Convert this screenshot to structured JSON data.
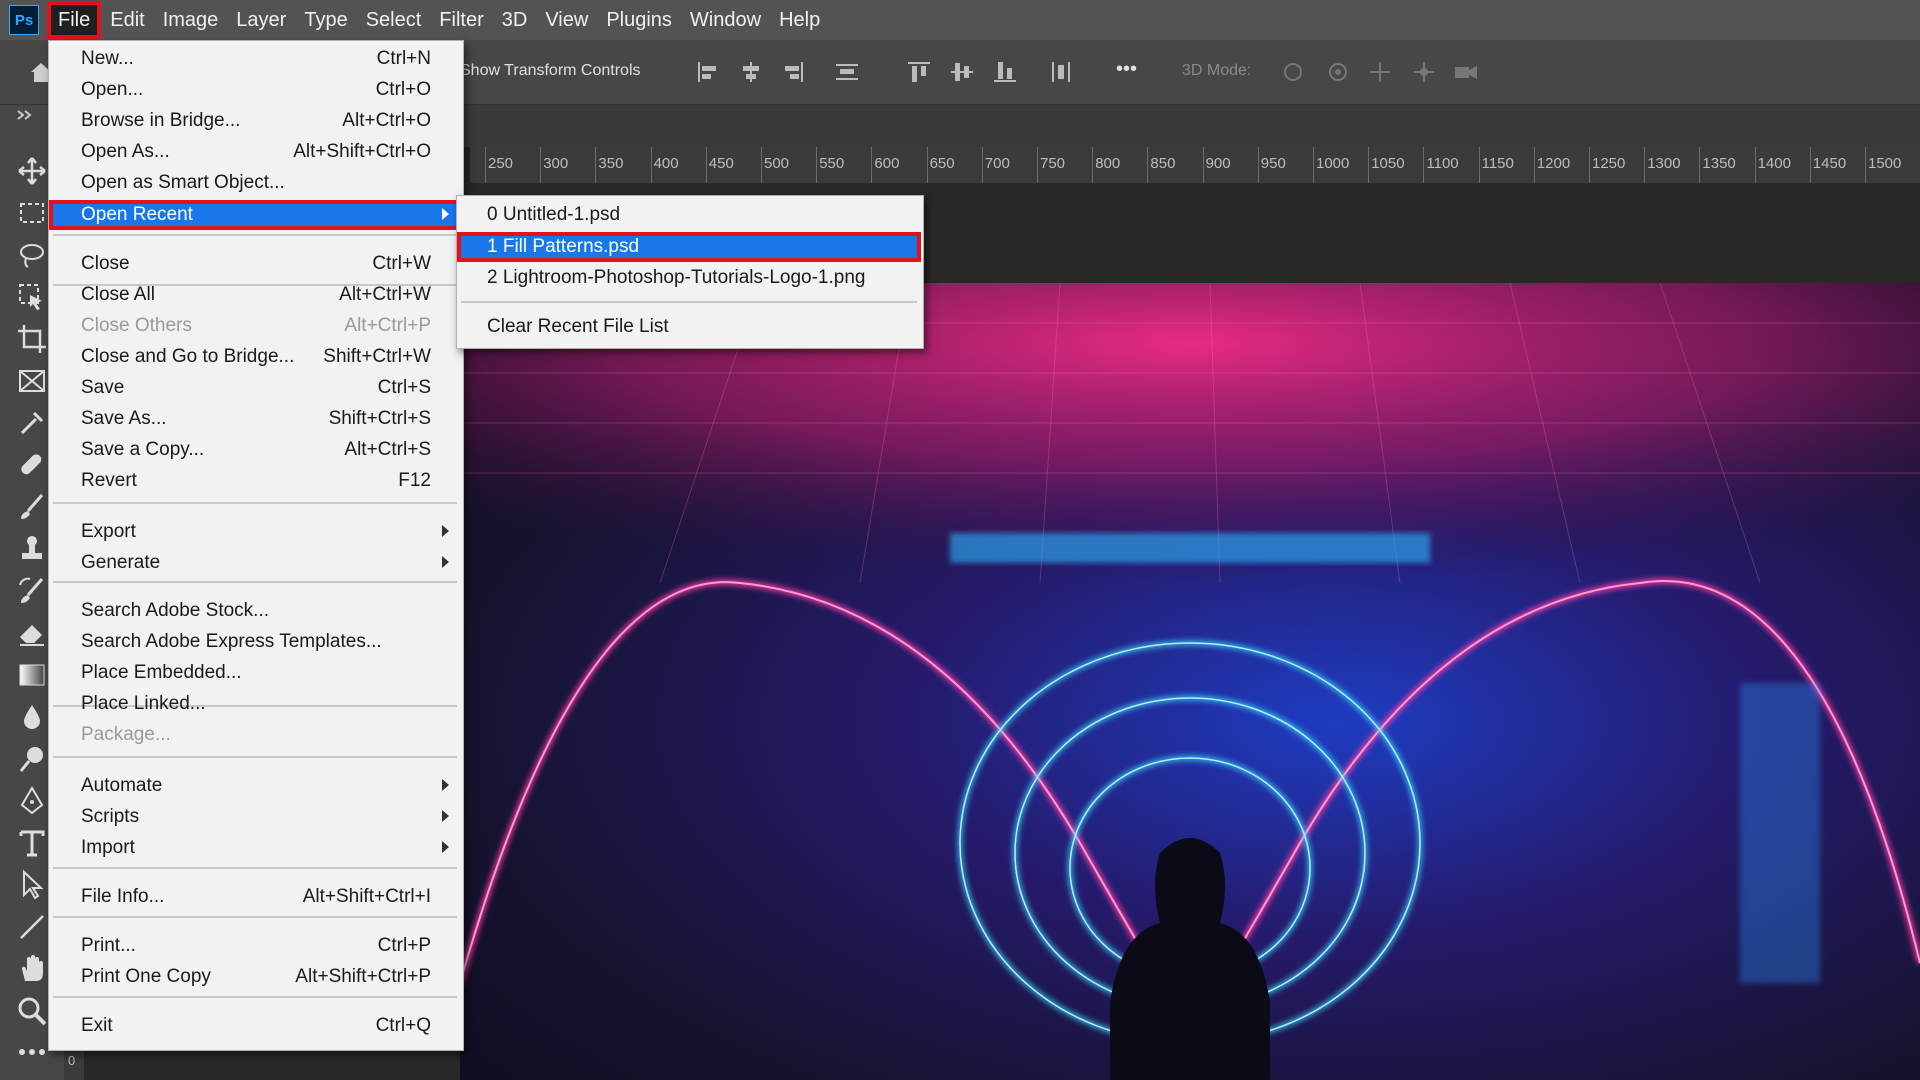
{
  "app": {
    "logo_text": "Ps",
    "accent": "#31a8ff"
  },
  "menubar": {
    "items": [
      "File",
      "Edit",
      "Image",
      "Layer",
      "Type",
      "Select",
      "Filter",
      "3D",
      "View",
      "Plugins",
      "Window",
      "Help"
    ],
    "active": "File"
  },
  "options_bar": {
    "transform_label": "Show Transform Controls",
    "mode_label": "3D Mode:",
    "more_label": "•••"
  },
  "ruler": {
    "ticks": [
      "250",
      "300",
      "350",
      "400",
      "450",
      "500",
      "550",
      "600",
      "650",
      "700",
      "750",
      "800",
      "850",
      "900",
      "950",
      "1000",
      "1050",
      "1100",
      "1150",
      "1200",
      "1250",
      "1300",
      "1350",
      "1400",
      "1450",
      "1500"
    ],
    "left_marker": "0"
  },
  "file_menu": {
    "items": [
      {
        "label": "New...",
        "shortcut": "Ctrl+N"
      },
      {
        "label": "Open...",
        "shortcut": "Ctrl+O"
      },
      {
        "label": "Browse in Bridge...",
        "shortcut": "Alt+Ctrl+O"
      },
      {
        "label": "Open As...",
        "shortcut": "Alt+Shift+Ctrl+O"
      },
      {
        "label": "Open as Smart Object...",
        "shortcut": ""
      },
      {
        "label": "Open Recent",
        "shortcut": "",
        "submenu": true,
        "highlighted": true
      },
      {
        "label": "Close",
        "shortcut": "Ctrl+W"
      },
      {
        "label": "Close All",
        "shortcut": "Alt+Ctrl+W"
      },
      {
        "label": "Close Others",
        "shortcut": "Alt+Ctrl+P",
        "disabled": true
      },
      {
        "label": "Close and Go to Bridge...",
        "shortcut": "Shift+Ctrl+W"
      },
      {
        "label": "Save",
        "shortcut": "Ctrl+S"
      },
      {
        "label": "Save As...",
        "shortcut": "Shift+Ctrl+S"
      },
      {
        "label": "Save a Copy...",
        "shortcut": "Alt+Ctrl+S"
      },
      {
        "label": "Revert",
        "shortcut": "F12"
      },
      {
        "label": "Export",
        "shortcut": "",
        "submenu": true
      },
      {
        "label": "Generate",
        "shortcut": "",
        "submenu": true
      },
      {
        "label": "Search Adobe Stock...",
        "shortcut": ""
      },
      {
        "label": "Search Adobe Express Templates...",
        "shortcut": ""
      },
      {
        "label": "Place Embedded...",
        "shortcut": ""
      },
      {
        "label": "Place Linked...",
        "shortcut": ""
      },
      {
        "label": "Package...",
        "shortcut": "",
        "disabled": true
      },
      {
        "label": "Automate",
        "shortcut": "",
        "submenu": true
      },
      {
        "label": "Scripts",
        "shortcut": "",
        "submenu": true
      },
      {
        "label": "Import",
        "shortcut": "",
        "submenu": true
      },
      {
        "label": "File Info...",
        "shortcut": "Alt+Shift+Ctrl+I"
      },
      {
        "label": "Print...",
        "shortcut": "Ctrl+P"
      },
      {
        "label": "Print One Copy",
        "shortcut": "Alt+Shift+Ctrl+P"
      },
      {
        "label": "Exit",
        "shortcut": "Ctrl+Q"
      }
    ]
  },
  "open_recent_submenu": {
    "items": [
      {
        "label": "0  Untitled-1.psd"
      },
      {
        "label": "1  Fill Patterns.psd",
        "highlighted": true
      },
      {
        "label": "2  Lightroom-Photoshop-Tutorials-Logo-1.png"
      },
      {
        "label": "Clear Recent File List"
      }
    ]
  },
  "colors": {
    "highlight": "#1a77ea",
    "callout": "#e3111b",
    "menu_bg": "#f2f2f2"
  }
}
